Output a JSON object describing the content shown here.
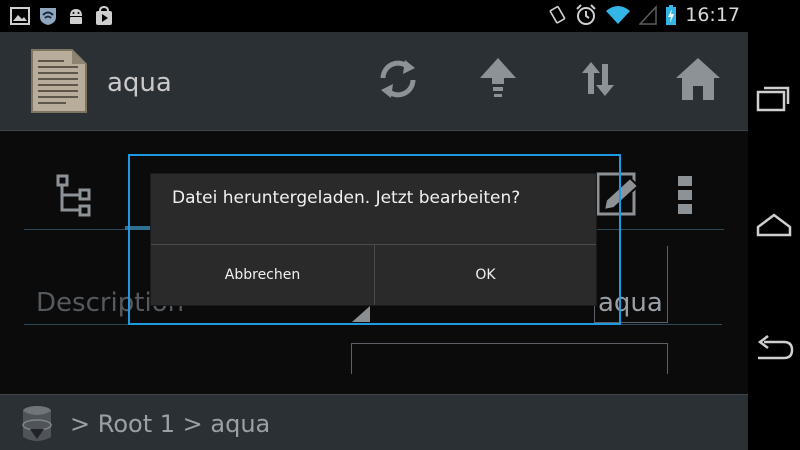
{
  "status_bar": {
    "time": "16:17",
    "left_icons": [
      "image-icon",
      "wifi-shield-icon",
      "android-icon",
      "play-store-icon"
    ],
    "right_icons": [
      "rotate-icon",
      "alarm-icon",
      "wifi-icon",
      "signal-icon",
      "battery-charging-icon"
    ]
  },
  "action_bar": {
    "title": "aqua",
    "app_icon": "document-icon",
    "buttons": [
      "sync-icon",
      "up-arrow-icon",
      "transfer-icon",
      "home-icon"
    ]
  },
  "toolbar": {
    "buttons": [
      "tree-icon",
      "edit-icon",
      "overflow-menu-icon"
    ]
  },
  "content": {
    "description_label": "Description",
    "aqua_value": "aqua"
  },
  "breadcrumb": {
    "text": "> Root 1 > aqua"
  },
  "dialog": {
    "message": "Datei heruntergeladen. Jetzt bearbeiten?",
    "cancel_label": "Abbrechen",
    "ok_label": "OK"
  },
  "nav_bar": {
    "buttons": [
      "recent-apps-icon",
      "home-nav-icon",
      "back-icon"
    ]
  },
  "colors": {
    "highlight": "#1e9be0",
    "bar_background": "#2b3035"
  }
}
